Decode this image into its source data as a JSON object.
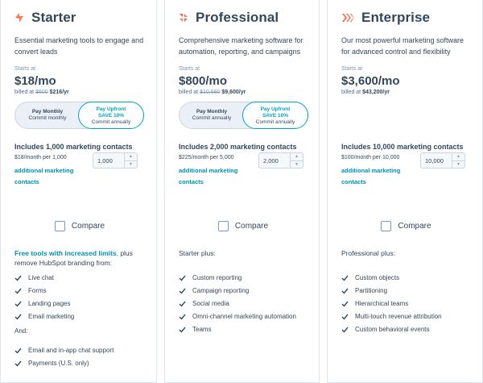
{
  "plans": [
    {
      "name": "Starter",
      "logo_color": "#ff7a59",
      "description": "Essential marketing tools to engage and convert leads",
      "starts_at": "Starts at",
      "price": "$18/mo",
      "billed_prefix": "billed at",
      "billed_old": "$600",
      "billed_new": "$216/yr",
      "toggle": {
        "left_title": "Pay Monthly",
        "left_sub": "Commit monthly",
        "right_title": "Pay Upfront",
        "right_save": "SAVE 10%",
        "right_sub": "Commit annually"
      },
      "includes": "Includes 1,000 marketing contacts",
      "per_month": "$18/month per 1,000",
      "additional": "additional marketing contacts",
      "stepper_value": "1,000",
      "compare": "Compare",
      "plus_highlight": "Free tools with increased limits",
      "plus_rest": ", plus remove HubSpot branding from:",
      "features": [
        "Live chat",
        "Forms",
        "Landing pages",
        "Email marketing"
      ],
      "and_label": "And:",
      "extra_features": [
        "Email and in-app chat support",
        "Payments (U.S. only)"
      ]
    },
    {
      "name": "Professional",
      "logo_color": "#ff5c35",
      "description": "Comprehensive marketing software for automation, reporting, and campaigns",
      "starts_at": "Starts at",
      "price": "$800/mo",
      "billed_prefix": "billed at",
      "billed_old": "$10,680",
      "billed_new": "$9,600/yr",
      "toggle": {
        "left_title": "Pay Monthly",
        "left_sub": "Commit annually",
        "right_title": "Pay Upfront",
        "right_save": "SAVE 10%",
        "right_sub": "Commit annually"
      },
      "includes": "Includes 2,000 marketing contacts",
      "per_month": "$225/month per 5,000",
      "additional": "additional marketing contacts",
      "stepper_value": "2,000",
      "compare": "Compare",
      "plus_label": "Starter plus:",
      "features": [
        "Custom reporting",
        "Campaign reporting",
        "Social media",
        "Omni-channel marketing automation",
        "Teams"
      ]
    },
    {
      "name": "Enterprise",
      "logo_color": "#ff5c35",
      "description": "Our most powerful marketing software for advanced control and flexibility",
      "starts_at": "Starts at",
      "price": "$3,600/mo",
      "billed_prefix": "billed at",
      "billed_new": "$43,200/yr",
      "includes": "Includes 10,000 marketing contacts",
      "per_month": "$100/month per 10,000",
      "additional": "additional marketing contacts",
      "stepper_value": "10,000",
      "compare": "Compare",
      "plus_label": "Professional plus:",
      "features": [
        "Custom objects",
        "Partitioning",
        "Hierarchical teams",
        "Multi-touch revenue attribution",
        "Custom behavioral events"
      ]
    }
  ],
  "colors": {
    "accent": "#00a4bd",
    "link": "#0091ae",
    "text": "#33475b",
    "check": "#33475b"
  },
  "icons": {
    "check": "checkmark-icon",
    "stepper_up": "chevron-up-icon",
    "stepper_down": "chevron-down-icon"
  }
}
